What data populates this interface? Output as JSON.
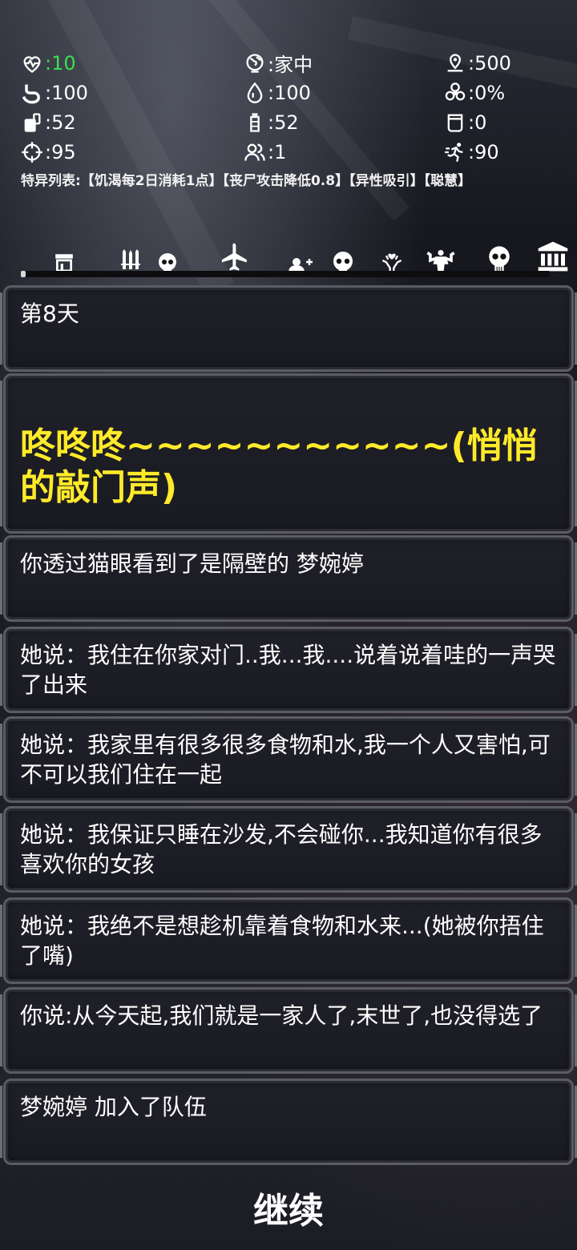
{
  "stats": {
    "health": {
      "icon": "heartbeat-icon",
      "value": ":10",
      "color": "#39e04a"
    },
    "location": {
      "icon": "globe-icon",
      "value": ":家中"
    },
    "distance": {
      "icon": "location-pin-icon",
      "value": ":500"
    },
    "hunger": {
      "icon": "stomach-icon",
      "value": ":100"
    },
    "thirst": {
      "icon": "water-drop-icon",
      "value": ":100"
    },
    "infection": {
      "icon": "biohazard-icon",
      "value": ":0%"
    },
    "food": {
      "icon": "food-can-icon",
      "value": ":52"
    },
    "water": {
      "icon": "water-bottle-icon",
      "value": ":52"
    },
    "bullets": {
      "icon": "cup-icon",
      "value": ":0"
    },
    "accuracy": {
      "icon": "crosshair-icon",
      "value": ":95"
    },
    "team": {
      "icon": "people-icon",
      "value": ":1"
    },
    "agility": {
      "icon": "running-icon",
      "value": ":90"
    }
  },
  "traits": "特异列表:【饥渴每2日消耗1点】【丧尸攻击降低0.8】【异性吸引】【聪慧】",
  "tabs": [
    {
      "icon": "shop-icon"
    },
    {
      "icon": "weapons-skull-icon"
    },
    {
      "icon": "airplane-icon"
    },
    {
      "icon": "add-member-skull-icon"
    },
    {
      "icon": "heal-skull-icon"
    },
    {
      "icon": "muscle-icon"
    },
    {
      "icon": "skull-icon"
    },
    {
      "icon": "bank-icon"
    }
  ],
  "log": [
    "第8天",
    "咚咚咚~~~~~~~~~~~(悄悄的敲门声)",
    "你透过猫眼看到了是隔壁的 梦婉婷",
    "她说：我住在你家对门..我...我....说着说着哇的一声哭了出来",
    "她说：我家里有很多很多食物和水,我一个人又害怕,可不可以我们住在一起",
    "她说：我保证只睡在沙发,不会碰你...我知道你有很多喜欢你的女孩",
    "她说：我绝不是想趁机靠着食物和水来...(她被你捂住了嘴)",
    "你说:从今天起,我们就是一家人了,末世了,也没得选了",
    "梦婉婷 加入了队伍"
  ],
  "continue_label": "继续",
  "colors": {
    "highlight": "#ffea2a",
    "health": "#39e04a"
  }
}
